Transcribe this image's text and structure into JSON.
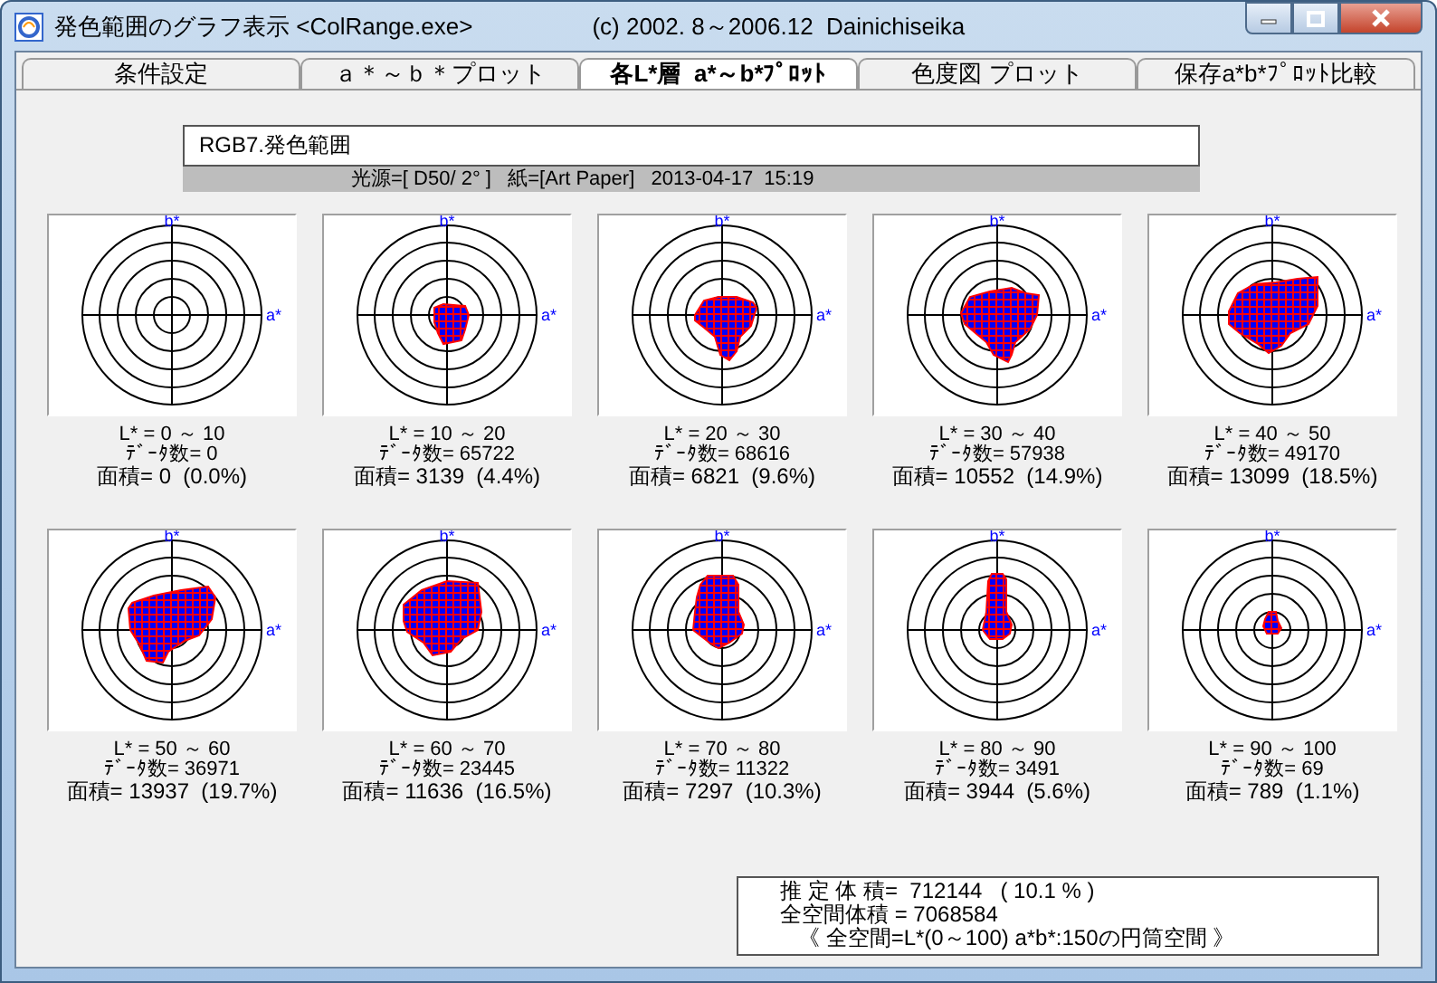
{
  "window": {
    "title": "発色範囲のグラフ表示 <ColRange.exe>",
    "copyright": "(c) 2002. 8～2006.12  Dainichiseika"
  },
  "tabs": [
    {
      "label": "条件設定",
      "selected": false
    },
    {
      "label": "ａ＊～ｂ＊プロット",
      "selected": false
    },
    {
      "label": "各L*層  a*～b*ﾌﾟﾛｯﾄ",
      "selected": true
    },
    {
      "label": "色度図 プロット",
      "selected": false
    },
    {
      "label": "保存a*b*ﾌﾟﾛｯﾄ比較",
      "selected": false
    }
  ],
  "header": {
    "name": "RGB7.発色範囲",
    "conditions": "光源=[ D50/ 2° ]   紙=[Art Paper]   2013-04-17  15:19"
  },
  "plots": [
    {
      "b_axis": "b*",
      "a_axis": "a*",
      "range": "L* = 0 ～ 10",
      "count": "ﾃﾞｰﾀ数= 0",
      "area": "面積= 0  (0.0%)"
    },
    {
      "b_axis": "b*",
      "a_axis": "a*",
      "range": "L* = 10 ～ 20",
      "count": "ﾃﾞｰﾀ数= 65722",
      "area": "面積= 3139  (4.4%)"
    },
    {
      "b_axis": "b*",
      "a_axis": "a*",
      "range": "L* = 20 ～ 30",
      "count": "ﾃﾞｰﾀ数= 68616",
      "area": "面積= 6821  (9.6%)"
    },
    {
      "b_axis": "b*",
      "a_axis": "a*",
      "range": "L* = 30 ～ 40",
      "count": "ﾃﾞｰﾀ数= 57938",
      "area": "面積= 10552  (14.9%)"
    },
    {
      "b_axis": "b*",
      "a_axis": "a*",
      "range": "L* = 40 ～ 50",
      "count": "ﾃﾞｰﾀ数= 49170",
      "area": "面積= 13099  (18.5%)"
    },
    {
      "b_axis": "b*",
      "a_axis": "a*",
      "range": "L* = 50 ～ 60",
      "count": "ﾃﾞｰﾀ数= 36971",
      "area": "面積= 13937  (19.7%)"
    },
    {
      "b_axis": "b*",
      "a_axis": "a*",
      "range": "L* = 60 ～ 70",
      "count": "ﾃﾞｰﾀ数= 23445",
      "area": "面積= 11636  (16.5%)"
    },
    {
      "b_axis": "b*",
      "a_axis": "a*",
      "range": "L* = 70 ～ 80",
      "count": "ﾃﾞｰﾀ数= 11322",
      "area": "面積= 7297  (10.3%)"
    },
    {
      "b_axis": "b*",
      "a_axis": "a*",
      "range": "L* = 80 ～ 90",
      "count": "ﾃﾞｰﾀ数= 3491",
      "area": "面積= 3944  (5.6%)"
    },
    {
      "b_axis": "b*",
      "a_axis": "a*",
      "range": "L* = 90 ～ 100",
      "count": "ﾃﾞｰﾀ数= 69",
      "area": "面積= 789  (1.1%)"
    }
  ],
  "summary": [
    "推 定 体 積=  712144   ( 10.1 % )",
    "全空間体積 = 7068584",
    "《 全空間=L*(0～100) a*b*:150の円筒空間 》"
  ]
}
